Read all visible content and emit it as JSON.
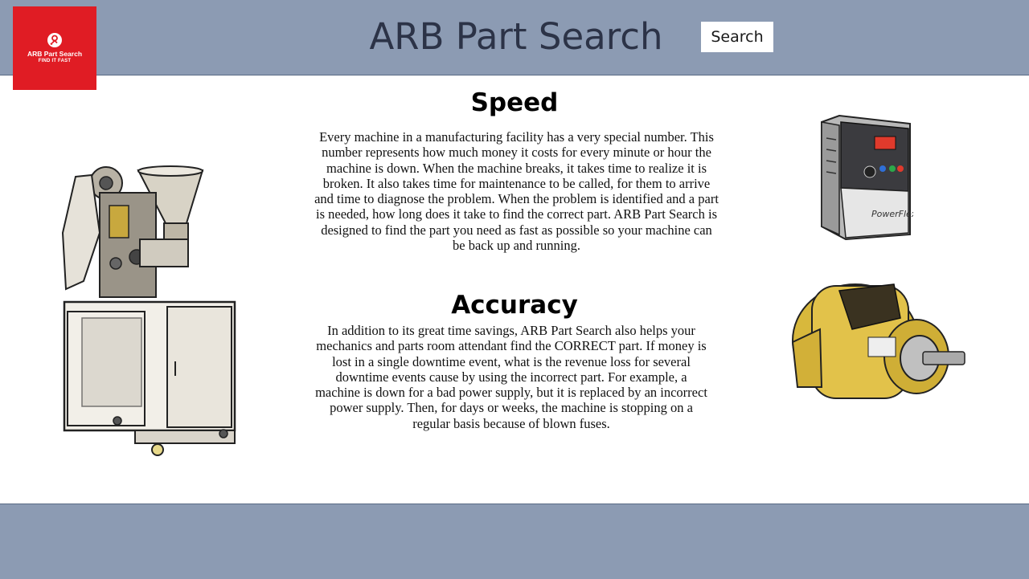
{
  "header": {
    "logo": {
      "name": "ARB Part Search",
      "tagline": "FIND IT FAST"
    },
    "title": "ARB Part Search",
    "search_label": "Search"
  },
  "sections": [
    {
      "heading": "Speed",
      "body": "Every machine in a manufacturing facility has a very special number. This number represents how much money it costs for every minute or hour the machine is down. When the machine breaks, it takes time to realize it is broken. It also takes time for maintenance to be called, for them to arrive and time to diagnose the problem. When the problem is identified and a part is needed, how long does it take to find the correct part. ARB Part Search is designed to find the part you need as fast as possible so your machine can be back up and running."
    },
    {
      "heading": "Accuracy",
      "body": "In addition to its great time savings, ARB Part Search also helps your mechanics and parts room attendant find the CORRECT part. If money is lost in a single downtime event, what is the revenue loss for several downtime events cause by using the incorrect part. For example, a machine is down for a bad power supply, but it is replaced by an incorrect power supply. Then, for days or weeks, the machine is stopping on a regular basis because of blown fuses."
    }
  ],
  "images": {
    "drive_brand": "PowerFlex"
  },
  "colors": {
    "header_bg": "#8c9bb3",
    "logo_bg": "#e01c24",
    "title_text": "#2c3347"
  }
}
